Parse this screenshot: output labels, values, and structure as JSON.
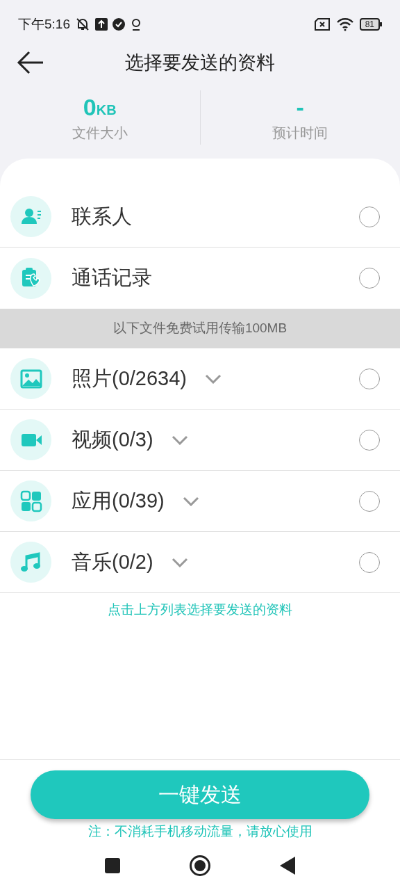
{
  "status_bar": {
    "time": "下午5:16",
    "battery": "81"
  },
  "header": {
    "title": "选择要发送的资料"
  },
  "stats": [
    {
      "value": "0",
      "unit": "KB",
      "label": "文件大小"
    },
    {
      "value": "-",
      "label": "预计时间"
    }
  ],
  "sections": [
    {
      "items": [
        {
          "label": "联系人",
          "kind": "basic",
          "selected": false
        },
        {
          "label": "通话记录",
          "kind": "basic",
          "selected": false
        }
      ]
    },
    {
      "banner": "以下文件免费试用传输100MB",
      "items": [
        {
          "label": "照片(0/2634)",
          "kind": "expandable",
          "selected": false
        },
        {
          "label": "视频(0/3)",
          "kind": "expandable",
          "selected": false
        },
        {
          "label": "应用(0/39)",
          "kind": "expandable",
          "selected": false
        },
        {
          "label": "音乐(0/2)",
          "kind": "expandable",
          "selected": false
        }
      ]
    }
  ],
  "hint": "点击上方列表选择要发送的资料",
  "send_button": "一键发送",
  "note": "注：不消耗手机移动流量，请放心使用"
}
